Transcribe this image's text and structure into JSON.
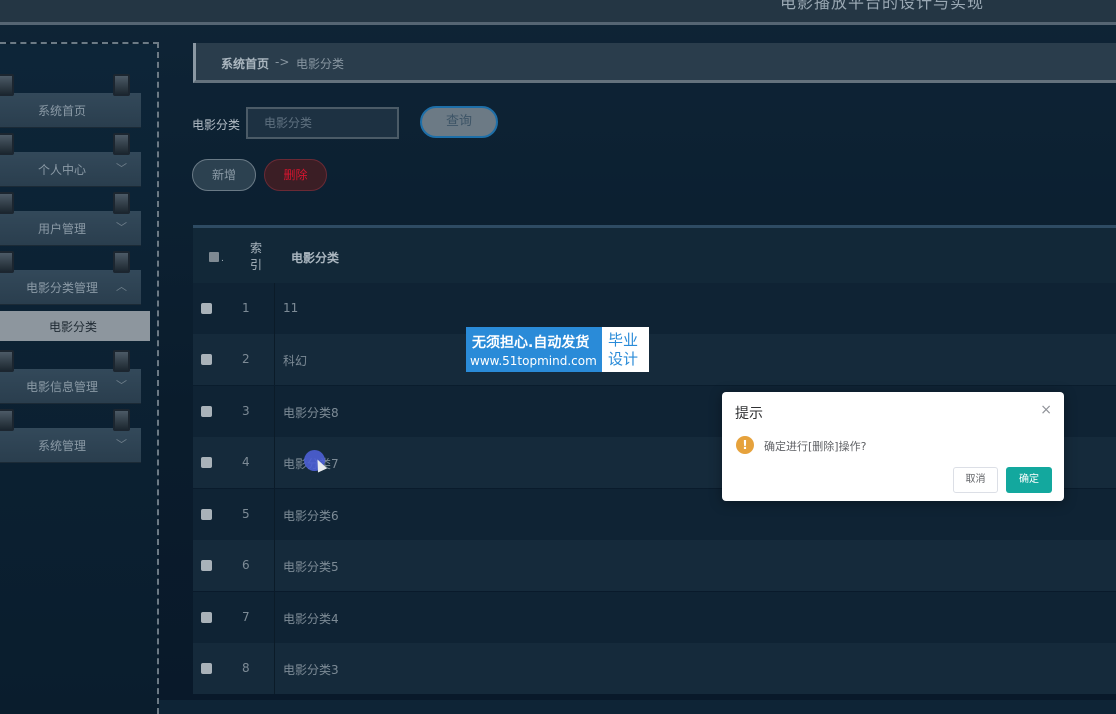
{
  "header": {
    "site_title": "电影播放平台的设计与实现"
  },
  "sidebar": {
    "items": [
      {
        "label": "系统首页",
        "chevron": ""
      },
      {
        "label": "个人中心",
        "chevron": "﹀"
      },
      {
        "label": "用户管理",
        "chevron": "﹀"
      },
      {
        "label": "电影分类管理",
        "chevron": "︿"
      },
      {
        "label": "电影信息管理",
        "chevron": "﹀"
      },
      {
        "label": "系统管理",
        "chevron": "﹀"
      }
    ],
    "active_sub": "电影分类"
  },
  "breadcrumb": {
    "home": "系统首页",
    "separator": "->",
    "current": "电影分类"
  },
  "search": {
    "label": "电影分类",
    "placeholder": "电影分类",
    "query_button": "查询"
  },
  "actions": {
    "add": "新增",
    "delete": "删除"
  },
  "table": {
    "index_header": "索引",
    "name_header": "电影分类",
    "rows": [
      {
        "index": "1",
        "name": "11"
      },
      {
        "index": "2",
        "name": "科幻"
      },
      {
        "index": "3",
        "name": "电影分类8"
      },
      {
        "index": "4",
        "name": "电影分类7"
      },
      {
        "index": "5",
        "name": "电影分类6"
      },
      {
        "index": "6",
        "name": "电影分类5"
      },
      {
        "index": "7",
        "name": "电影分类4"
      },
      {
        "index": "8",
        "name": "电影分类3"
      }
    ]
  },
  "badge": {
    "line1": "无须担心.自动发货",
    "line2": "www.51topmind.com",
    "side_top": "毕业",
    "side_bottom": "设计"
  },
  "dialog": {
    "title": "提示",
    "close": "×",
    "icon": "warning-icon",
    "message": "确定进行[删除]操作?",
    "cancel": "取消",
    "confirm": "确定"
  },
  "colors": {
    "confirm": "#13a89e",
    "warning": "#e6a23c",
    "delete_text": "#d6152f",
    "badge": "#2a8bd8"
  }
}
